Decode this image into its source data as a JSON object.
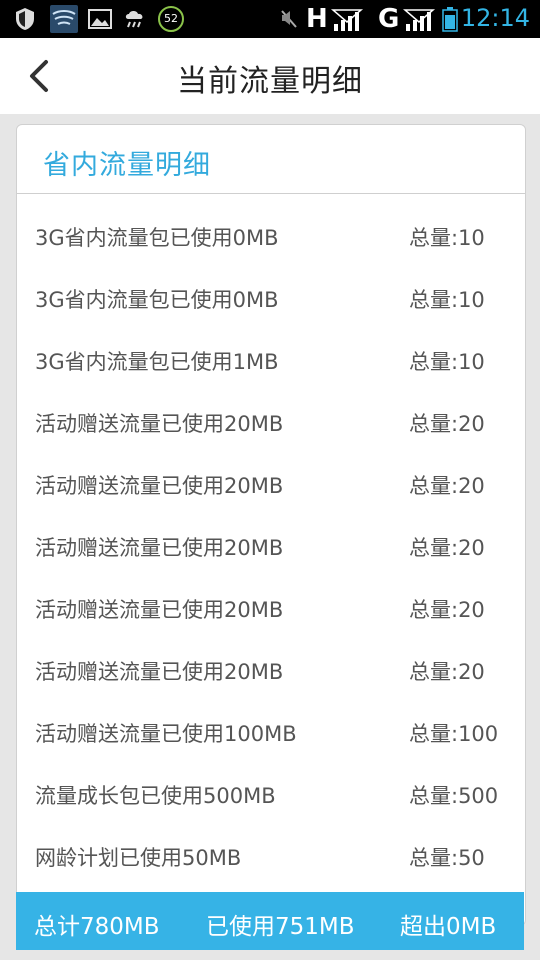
{
  "status_bar": {
    "time": "12:14",
    "notification_count": "52",
    "network_h": "H",
    "network_g": "G",
    "icons": [
      "shield-icon",
      "swirl-icon",
      "image-icon",
      "weather-icon",
      "notification-badge",
      "mute-icon",
      "signal-icon",
      "signal-icon",
      "battery-icon"
    ]
  },
  "header": {
    "title": "当前流量明细",
    "back_icon": "chevron-left-icon"
  },
  "card": {
    "title": "省内流量明细",
    "rows": [
      {
        "label": "3G省内流量包已使用0MB",
        "total": "总量:10"
      },
      {
        "label": "3G省内流量包已使用0MB",
        "total": "总量:10"
      },
      {
        "label": "3G省内流量包已使用1MB",
        "total": "总量:10"
      },
      {
        "label": "活动赠送流量已使用20MB",
        "total": "总量:20"
      },
      {
        "label": "活动赠送流量已使用20MB",
        "total": "总量:20"
      },
      {
        "label": "活动赠送流量已使用20MB",
        "total": "总量:20"
      },
      {
        "label": "活动赠送流量已使用20MB",
        "total": "总量:20"
      },
      {
        "label": "活动赠送流量已使用20MB",
        "total": "总量:20"
      },
      {
        "label": "活动赠送流量已使用100MB",
        "total": "总量:100"
      },
      {
        "label": "流量成长包已使用500MB",
        "total": "总量:500"
      },
      {
        "label": "网龄计划已使用50MB",
        "total": "总量:50"
      }
    ]
  },
  "footer": {
    "total": "总计780MB",
    "used": "已使用751MB",
    "exceeded": "超出0MB"
  },
  "colors": {
    "accent": "#33aadd",
    "footer_bg": "#36b3e6",
    "time_color": "#33b5e5"
  }
}
